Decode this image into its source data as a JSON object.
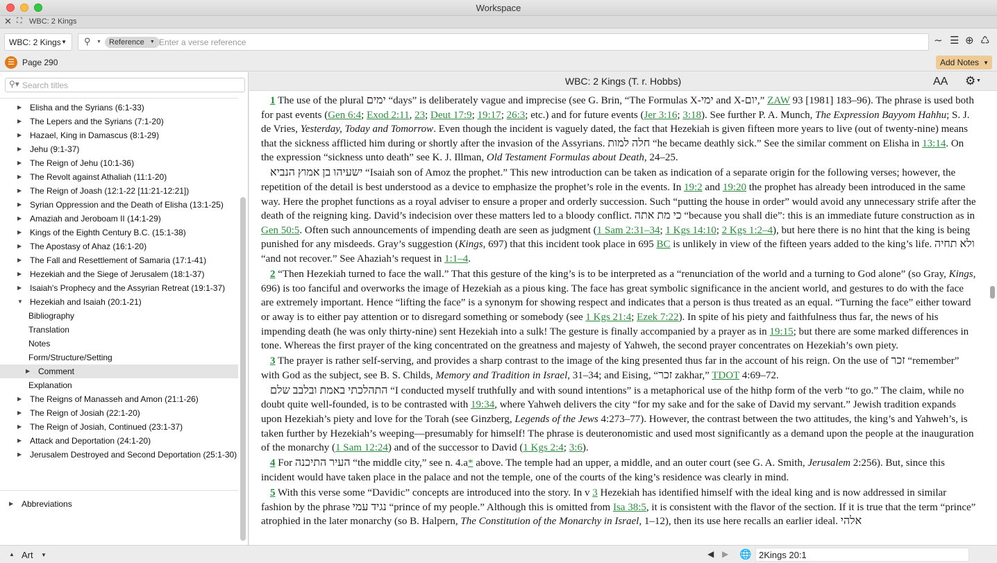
{
  "window": {
    "title": "Workspace"
  },
  "tab": {
    "label": "WBC: 2 Kings",
    "close_glyph": "✕",
    "expand_glyph": "⛶"
  },
  "toolbar": {
    "book": "WBC: 2 Kings",
    "search_mode": "Reference",
    "search_placeholder": "Enter a verse reference",
    "icons": [
      "waveform-icon",
      "list-lines-icon",
      "add-circle-icon",
      "recycle-icon"
    ]
  },
  "pagebar": {
    "page": "Page 290",
    "add_notes": "Add Notes"
  },
  "sidebar": {
    "search_placeholder": "Search titles",
    "items": [
      {
        "label": "Elisha and the Syrians (6:1-33)",
        "level": 1,
        "state": "collapsed"
      },
      {
        "label": "The Lepers and the Syrians (7:1-20)",
        "level": 1,
        "state": "collapsed"
      },
      {
        "label": "Hazael, King in Damascus (8:1-29)",
        "level": 1,
        "state": "collapsed"
      },
      {
        "label": "Jehu (9:1-37)",
        "level": 1,
        "state": "collapsed"
      },
      {
        "label": "The Reign of Jehu (10:1-36)",
        "level": 1,
        "state": "collapsed"
      },
      {
        "label": "The Revolt against Athaliah (11:1-20)",
        "level": 1,
        "state": "collapsed"
      },
      {
        "label": "The Reign of Joash (12:1-22 [11:21-12:21])",
        "level": 1,
        "state": "collapsed"
      },
      {
        "label": "Syrian Oppression and the Death of Elisha (13:1-25)",
        "level": 1,
        "state": "collapsed"
      },
      {
        "label": "Amaziah and Jeroboam II (14:1-29)",
        "level": 1,
        "state": "collapsed"
      },
      {
        "label": "Kings of the Eighth Century B.C.  (15:1-38)",
        "level": 1,
        "state": "collapsed"
      },
      {
        "label": "The Apostasy of Ahaz (16:1-20)",
        "level": 1,
        "state": "collapsed"
      },
      {
        "label": "The Fall and Resettlement of Samaria (17:1-41)",
        "level": 1,
        "state": "collapsed"
      },
      {
        "label": "Hezekiah and the Siege of Jerusalem (18:1-37)",
        "level": 1,
        "state": "collapsed"
      },
      {
        "label": "Isaiah's Prophecy and the Assyrian Retreat (19:1-37)",
        "level": 1,
        "state": "collapsed"
      },
      {
        "label": "Hezekiah and Isaiah (20:1-21)",
        "level": 1,
        "state": "expanded"
      },
      {
        "label": "Bibliography",
        "level": 2,
        "state": "leaf"
      },
      {
        "label": "Translation",
        "level": 2,
        "state": "leaf"
      },
      {
        "label": "Notes",
        "level": 2,
        "state": "leaf"
      },
      {
        "label": "Form/Structure/Setting",
        "level": 2,
        "state": "leaf"
      },
      {
        "label": "Comment",
        "level": 2,
        "state": "collapsed",
        "selected": true
      },
      {
        "label": "Explanation",
        "level": 2,
        "state": "leaf"
      },
      {
        "label": "The Reigns of Manasseh and Amon (21:1-26)",
        "level": 1,
        "state": "collapsed"
      },
      {
        "label": "The Reign of Josiah (22:1-20)",
        "level": 1,
        "state": "collapsed"
      },
      {
        "label": "The Reign of Josiah, Continued (23:1-37)",
        "level": 1,
        "state": "collapsed"
      },
      {
        "label": "Attack and Deportation (24:1-20)",
        "level": 1,
        "state": "collapsed"
      },
      {
        "label": "Jerusalem Destroyed and Second Deportation (25:1-30)",
        "level": 1,
        "state": "collapsed"
      }
    ],
    "footer_item": "Abbreviations"
  },
  "reader": {
    "title": "WBC: 2 Kings (T. r. Hobbs)",
    "text_size_icon": "AA",
    "paragraphs": [
      [
        {
          "t": "1",
          "k": "vn"
        },
        {
          "t": " The use of the plural "
        },
        {
          "t": "ימים",
          "k": "he"
        },
        {
          "t": " “days” is deliberately vague and imprecise (see G. Brin, “The Formulas X-"
        },
        {
          "t": "ימי",
          "k": "he"
        },
        {
          "t": " and X-"
        },
        {
          "t": "יום",
          "k": "he"
        },
        {
          "t": ",” "
        },
        {
          "t": "ZAW",
          "k": "lk"
        },
        {
          "t": " 93 [1981] 183–96). The phrase is used both for past events ("
        },
        {
          "t": "Gen 6:4",
          "k": "lk"
        },
        {
          "t": "; "
        },
        {
          "t": "Exod 2:11",
          "k": "lk"
        },
        {
          "t": ", "
        },
        {
          "t": "23",
          "k": "lk"
        },
        {
          "t": "; "
        },
        {
          "t": "Deut 17:9",
          "k": "lk"
        },
        {
          "t": "; "
        },
        {
          "t": "19:17",
          "k": "lk"
        },
        {
          "t": "; "
        },
        {
          "t": "26:3",
          "k": "lk"
        },
        {
          "t": "; etc.) and for future events ("
        },
        {
          "t": "Jer 3:16",
          "k": "lk"
        },
        {
          "t": "; "
        },
        {
          "t": "3:18",
          "k": "lk"
        },
        {
          "t": "). See further P. A. Munch, "
        },
        {
          "t": "The Expression Bayyom Hahhu",
          "k": "i"
        },
        {
          "t": "; S. J. de Vries, "
        },
        {
          "t": "Yesterday, Today and Tomorrow",
          "k": "i"
        },
        {
          "t": ". Even though the incident is vaguely dated, the fact that Hezekiah is given fifteen more years to live (out of twenty-nine) means that the sickness afflicted him during or shortly after the invasion of the Assyrians. "
        },
        {
          "t": "חלה למות",
          "k": "he"
        },
        {
          "t": " “he became deathly sick.” See the similar comment on Elisha in "
        },
        {
          "t": "13:14",
          "k": "lk"
        },
        {
          "t": ". On the expression “sickness unto death” see K. J. Illman, "
        },
        {
          "t": "Old Testament Formulas about Death",
          "k": "i"
        },
        {
          "t": ", 24–25."
        }
      ],
      [
        {
          "t": "ישעיהו בן אמוץ הנביא",
          "k": "he"
        },
        {
          "t": " “Isaiah son of Amoz the prophet.” This new introduction can be taken as indication of a separate origin for the following verses; however, the repetition of the detail is best understood as a device to emphasize the prophet’s role in the events. In "
        },
        {
          "t": "19:2",
          "k": "lk"
        },
        {
          "t": " and "
        },
        {
          "t": "19:20",
          "k": "lk"
        },
        {
          "t": " the prophet has already been introduced in the same way. Here the prophet functions as a royal adviser to ensure a proper and orderly succession. Such “putting the house in order” would avoid any unnecessary strife after the death of the reigning king. David’s indecision over these matters led to a bloody conflict. "
        },
        {
          "t": "כי מת אתה",
          "k": "he"
        },
        {
          "t": " “because you shall die”: this is an immediate future construction as in "
        },
        {
          "t": "Gen 50:5",
          "k": "lk"
        },
        {
          "t": ". Often such announcements of impending death are seen as judgment ("
        },
        {
          "t": "1 Sam 2:31–34",
          "k": "lk"
        },
        {
          "t": "; "
        },
        {
          "t": "1 Kgs 14:10",
          "k": "lk"
        },
        {
          "t": "; "
        },
        {
          "t": "2 Kgs 1:2–4",
          "k": "lk"
        },
        {
          "t": "), but here there is no hint that the king is being punished for any misdeeds. Gray’s suggestion ("
        },
        {
          "t": "Kings",
          "k": "i"
        },
        {
          "t": ", 697) that this incident took place in 695 "
        },
        {
          "t": "BC",
          "k": "lk"
        },
        {
          "t": " is unlikely in view of the fifteen years added to the king’s life. "
        },
        {
          "t": "ולא תחיה",
          "k": "he"
        },
        {
          "t": " “and not recover.” See Ahaziah’s request in "
        },
        {
          "t": "1:1–4",
          "k": "lk"
        },
        {
          "t": "."
        }
      ],
      [
        {
          "t": "2",
          "k": "vn"
        },
        {
          "t": " “Then Hezekiah turned to face the wall.” That this gesture of the king’s is to be interpreted as a “renunciation of the world and a turning to God alone” (so Gray, "
        },
        {
          "t": "Kings",
          "k": "i"
        },
        {
          "t": ", 696) is too fanciful and overworks the image of Hezekiah as a pious king. The face has great symbolic significance in the ancient world, and gestures to do with the face are extremely important. Hence “lifting the face” is a synonym for showing respect and indicates that a person is thus treated as an equal. “Turning the face” either toward or away is to either pay attention or to disregard something or somebody (see "
        },
        {
          "t": "1 Kgs 21:4",
          "k": "lk"
        },
        {
          "t": "; "
        },
        {
          "t": "Ezek 7:22",
          "k": "lk"
        },
        {
          "t": "). In spite of his piety and faithfulness thus far, the news of his impending death (he was only thirty-nine) sent Hezekiah into a sulk! The gesture is finally accompanied by a prayer as in "
        },
        {
          "t": "19:15",
          "k": "lk"
        },
        {
          "t": "; but there are some marked differences in tone. Whereas the first prayer of the king concentrated on the greatness and majesty of Yahweh, the second prayer concentrates on Hezekiah’s own piety."
        }
      ],
      [
        {
          "t": "3",
          "k": "vn"
        },
        {
          "t": " The prayer is rather self-serving, and provides a sharp contrast to the image of the king presented thus far in the account of his reign. On the use of "
        },
        {
          "t": "זכר",
          "k": "he"
        },
        {
          "t": " “remember” with God as the subject, see B. S. Childs, "
        },
        {
          "t": "Memory and Tradition in Israel",
          "k": "i"
        },
        {
          "t": ", 31–34; and Eising, “"
        },
        {
          "t": "זכר",
          "k": "he"
        },
        {
          "t": " zakhar,” "
        },
        {
          "t": "TDOT",
          "k": "lk"
        },
        {
          "t": " 4:69–72."
        }
      ],
      [
        {
          "t": "התהלכתי באמת ובלבב שלם",
          "k": "he"
        },
        {
          "t": " “I conducted myself truthfully and with sound intentions” is a metaphorical use of the hithp form of the verb “to go.” The claim, while no doubt quite well-founded, is to be contrasted with "
        },
        {
          "t": "19:34",
          "k": "lk"
        },
        {
          "t": ", where Yahweh delivers the city “for my sake and for the sake of David my servant.” Jewish tradition expands upon Hezekiah’s piety and love for the Torah (see Ginzberg, "
        },
        {
          "t": "Legends of the Jews",
          "k": "i"
        },
        {
          "t": " 4:273–77). However, the contrast between the two attitudes, the king’s and Yahweh’s, is taken further by Hezekiah’s weeping—presumably for himself! The phrase is deuteronomistic and used most significantly as a demand upon the people at the inauguration of the monarchy ("
        },
        {
          "t": "1 Sam 12:24",
          "k": "lk"
        },
        {
          "t": ") and of the successor to David ("
        },
        {
          "t": "1 Kgs 2:4",
          "k": "lk"
        },
        {
          "t": "; "
        },
        {
          "t": "3:6",
          "k": "lk"
        },
        {
          "t": ")."
        }
      ],
      [
        {
          "t": "4",
          "k": "vn"
        },
        {
          "t": " For "
        },
        {
          "t": "העיר התיכנה",
          "k": "he"
        },
        {
          "t": " “the middle city,” see n. 4.a"
        },
        {
          "t": "*",
          "k": "lk"
        },
        {
          "t": " above. The temple had an upper, a middle, and an outer court (see G. A. Smith, "
        },
        {
          "t": "Jerusalem",
          "k": "i"
        },
        {
          "t": " 2:256). But, since this incident would have taken place in the palace and not the temple, one of the courts of the king’s residence was clearly in mind."
        }
      ],
      [
        {
          "t": "5",
          "k": "vn"
        },
        {
          "t": " With this verse some “Davidic” concepts are introduced into the story. In v "
        },
        {
          "t": "3",
          "k": "lk"
        },
        {
          "t": " Hezekiah has identified himself with the ideal king and is now addressed in similar fashion by the phrase "
        },
        {
          "t": "נגיד עמי",
          "k": "he"
        },
        {
          "t": " “prince of my people.” Although this is omitted from "
        },
        {
          "t": "Isa 38:5",
          "k": "lk"
        },
        {
          "t": ", it is consistent with the flavor of the section. If it is true that the term “prince” atrophied in the later monarchy (so B. Halpern, "
        },
        {
          "t": "The Constitution of the Monarchy in Israel",
          "k": "i"
        },
        {
          "t": ", 1–12), then its use here recalls an earlier ideal. "
        },
        {
          "t": "אלהי",
          "k": "he"
        }
      ]
    ]
  },
  "statusbar": {
    "layout": "Art",
    "location": "2Kings 20:1"
  },
  "colors": {
    "link": "#2a8c3c",
    "accent": "#e07b1a",
    "add_notes_bg": "#eecb94"
  }
}
